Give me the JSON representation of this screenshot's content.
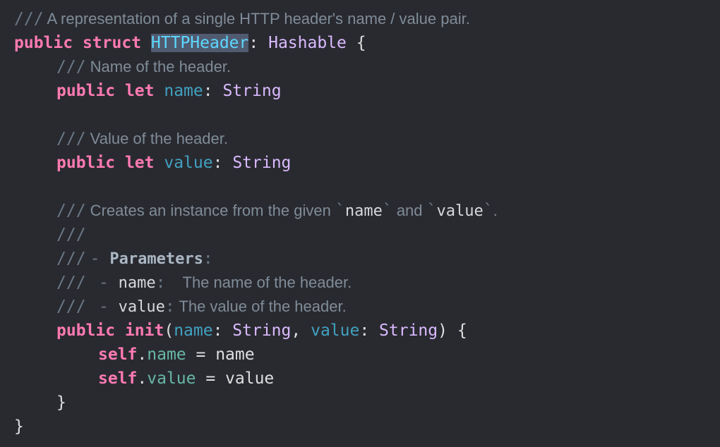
{
  "colors": {
    "background": "#292a30",
    "keyword": "#ff7ab2",
    "type": "#dabaff",
    "declaration": "#5dd8ff",
    "identifier": "#41a1c0",
    "property": "#67b7a4",
    "comment": "#7f8c98",
    "selection": "#515b70"
  },
  "code": {
    "doc_struct": "A representation of a single HTTP header's name / value pair.",
    "doc_slashes": "///",
    "kw_public": "public",
    "kw_struct": "struct",
    "kw_let": "let",
    "kw_init": "init",
    "kw_self": "self",
    "struct_name": "HTTPHeader",
    "protocol_name": "Hashable",
    "type_string": "String",
    "name_field": "name",
    "value_field": "value",
    "doc_name": "Name of the header.",
    "doc_value": "Value of the header.",
    "doc_init_prefix": "Creates an instance from the given",
    "doc_init_and": "and",
    "doc_params_title": "Parameters",
    "doc_param_name_desc": "The name of the header.",
    "doc_param_value_desc": "The value of the header.",
    "open_brace": "{",
    "close_brace": "}"
  }
}
